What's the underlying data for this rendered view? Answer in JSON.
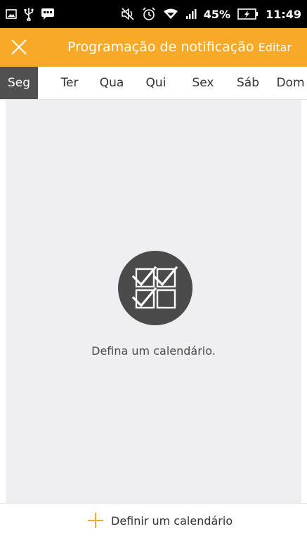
{
  "status_bar": {
    "battery_percent": "45%",
    "time": "11:49",
    "icons": [
      "image-icon",
      "usb-icon",
      "message-icon",
      "mute-icon",
      "alarm-icon",
      "wifi-icon",
      "signal-icon",
      "battery-charging-icon"
    ]
  },
  "app_bar": {
    "title": "Programação de notificação",
    "edit_label": "Editar",
    "close_icon": "close-icon"
  },
  "day_tabs": [
    {
      "label": "Seg",
      "active": true
    },
    {
      "label": "Ter",
      "active": false
    },
    {
      "label": "Qua",
      "active": false
    },
    {
      "label": "Qui",
      "active": false
    },
    {
      "label": "Sex",
      "active": false
    },
    {
      "label": "Sáb",
      "active": false
    },
    {
      "label": "Dom",
      "active": false
    }
  ],
  "empty_state": {
    "icon": "checklist-grid-icon",
    "message": "Defina um calendário."
  },
  "bottom_bar": {
    "define_label": "Definir um calendário",
    "icon": "plus-icon"
  },
  "colors": {
    "accent": "#f7a927",
    "active_tab": "#505050",
    "content_bg": "#efeff2",
    "status_bar": "#000000"
  }
}
